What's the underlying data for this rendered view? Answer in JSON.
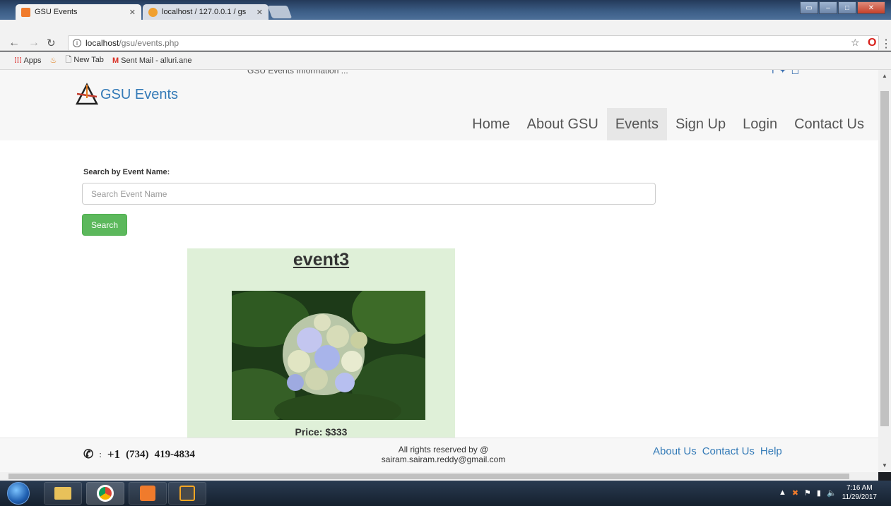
{
  "browser": {
    "tabs": [
      {
        "title": "GSU Events"
      },
      {
        "title": "localhost / 127.0.0.1 / gs"
      }
    ],
    "url_host": "localhost",
    "url_path": "/gsu/events.php",
    "bookmarks": [
      "Apps",
      "New Tab",
      "Sent Mail - alluri.ane"
    ]
  },
  "header": {
    "clipped_text": "GSU Events Information ...",
    "brand": "GSU Events",
    "menu": [
      {
        "label": "Home"
      },
      {
        "label": "About GSU"
      },
      {
        "label": "Events"
      },
      {
        "label": "Sign Up"
      },
      {
        "label": "Login"
      },
      {
        "label": "Contact Us"
      }
    ],
    "active_menu": "Events"
  },
  "search": {
    "label": "Search by Event Name:",
    "placeholder": "Search Event Name",
    "value": "",
    "button": "Search"
  },
  "event": {
    "title": "event3",
    "price": "Price: $333"
  },
  "footer": {
    "phone_colon": ":",
    "phone_code": "+1",
    "phone_area": "(734)",
    "phone_number": "419-4834",
    "rights_line1": "All rights reserved by @",
    "rights_line2": "sairam.sairam.reddy@gmail.com",
    "links": [
      "About Us",
      "Contact Us",
      "Help"
    ]
  },
  "taskbar": {
    "time": "7:16 AM",
    "date": "11/29/2017"
  },
  "colors": {
    "brand_blue": "#337ab7",
    "search_green": "#5cb85c",
    "card_green": "#dff0d8"
  }
}
